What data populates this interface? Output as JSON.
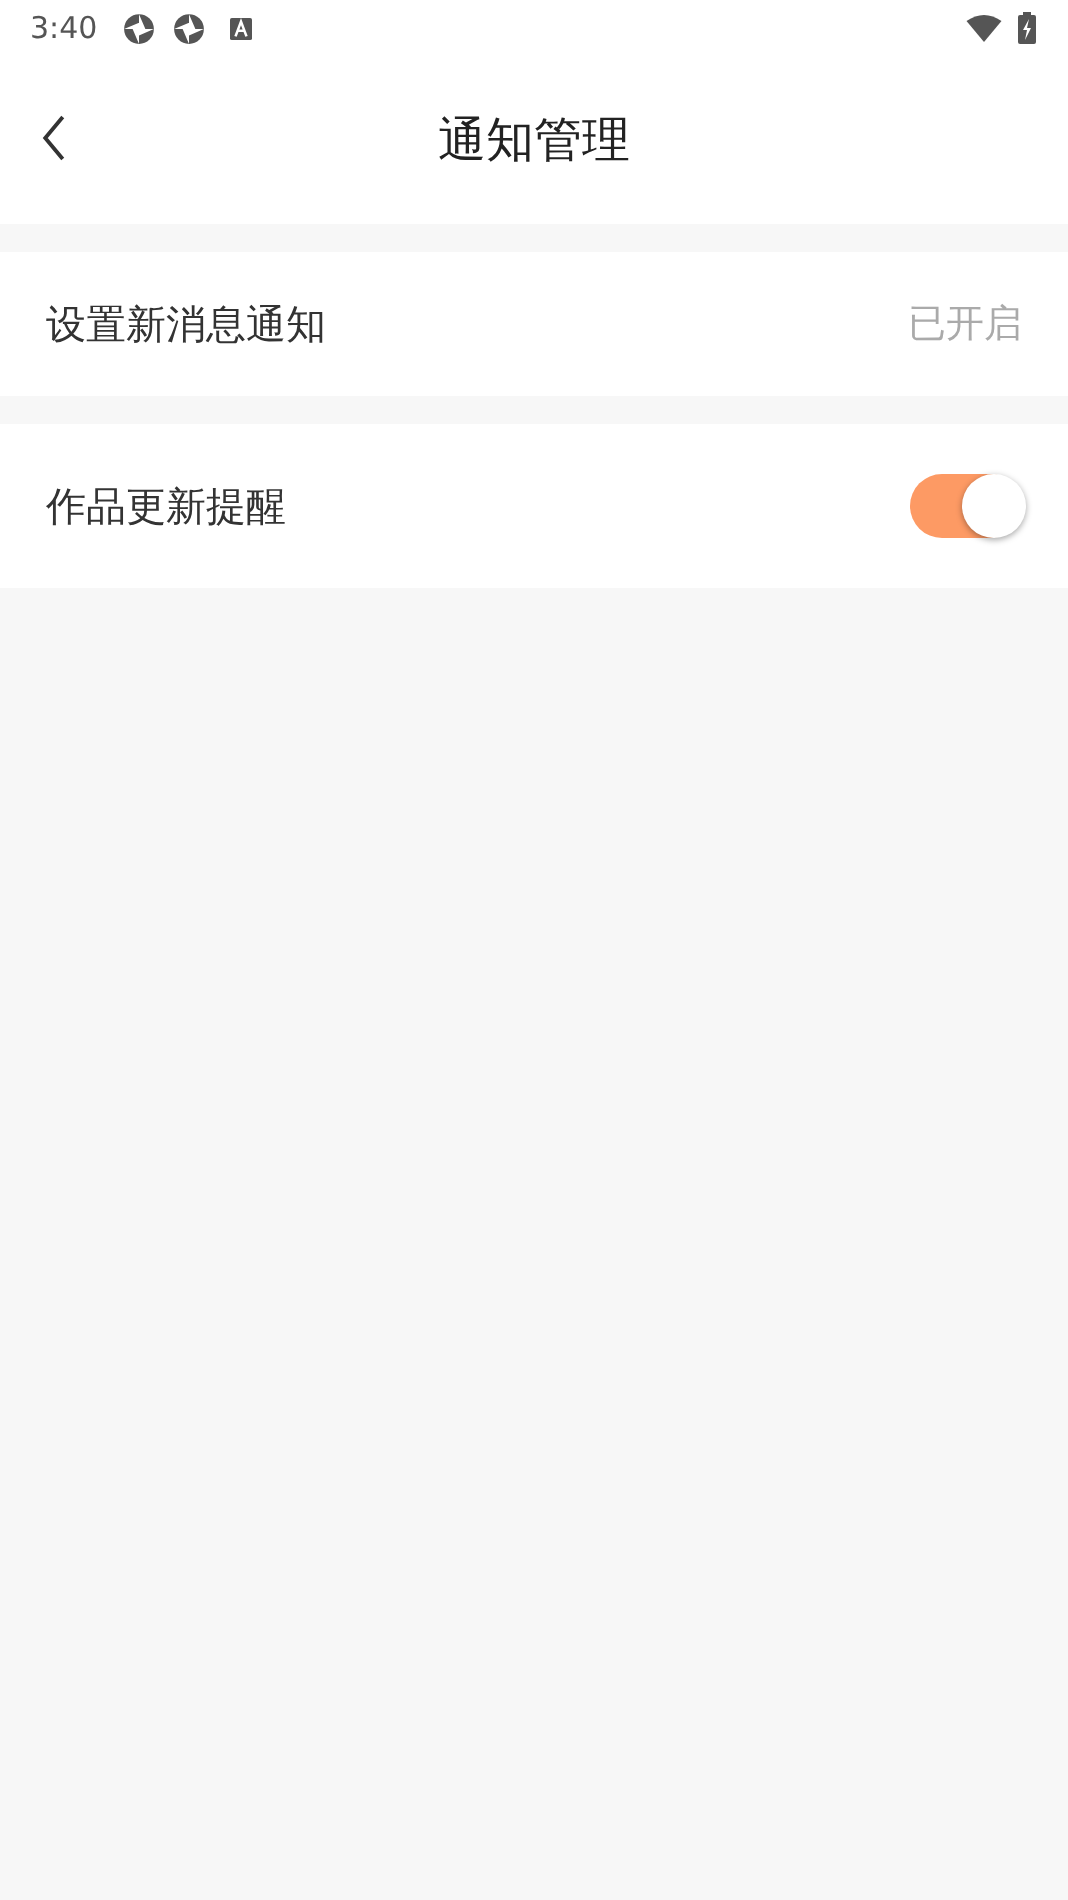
{
  "status_bar": {
    "time": "3:40"
  },
  "header": {
    "title": "通知管理"
  },
  "settings": [
    {
      "kind": "value",
      "label": "设置新消息通知",
      "value": "已开启"
    },
    {
      "kind": "switch",
      "label": "作品更新提醒",
      "on": true
    }
  ]
}
